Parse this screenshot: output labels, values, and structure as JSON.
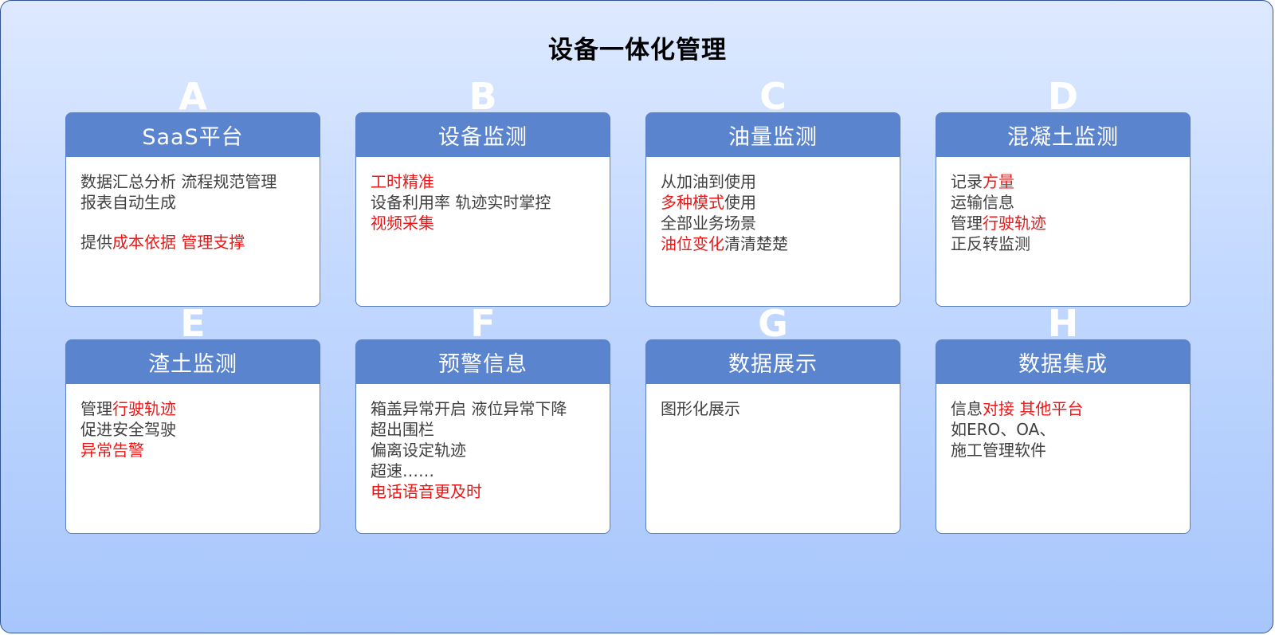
{
  "title": "设备一体化管理",
  "colors": {
    "header": "#5b84cf",
    "highlight": "#e81818",
    "text": "#404040"
  },
  "cards": [
    {
      "letter": "A",
      "title": "SaaS平台",
      "lines": [
        {
          "segments": [
            {
              "text": "数据汇总分析   流程规范管理",
              "highlight": false
            }
          ]
        },
        {
          "segments": [
            {
              "text": "报表自动生成",
              "highlight": false
            }
          ]
        },
        {
          "gap": true,
          "segments": [
            {
              "text": "提供",
              "highlight": false
            },
            {
              "text": "成本依据 管理支撑",
              "highlight": true
            }
          ]
        }
      ]
    },
    {
      "letter": "B",
      "title": "设备监测",
      "lines": [
        {
          "segments": [
            {
              "text": "工时精准",
              "highlight": true
            }
          ]
        },
        {
          "segments": [
            {
              "text": "设备利用率 轨迹实时掌控",
              "highlight": false
            }
          ]
        },
        {
          "segments": [
            {
              "text": "视频采集",
              "highlight": true
            }
          ]
        }
      ]
    },
    {
      "letter": "C",
      "title": "油量监测",
      "lines": [
        {
          "segments": [
            {
              "text": "从加油到使用",
              "highlight": false
            }
          ]
        },
        {
          "segments": [
            {
              "text": "多种模式",
              "highlight": true
            },
            {
              "text": "使用",
              "highlight": false
            }
          ]
        },
        {
          "segments": [
            {
              "text": "全部业务场景",
              "highlight": false
            }
          ]
        },
        {
          "segments": [
            {
              "text": "油位变化",
              "highlight": true
            },
            {
              "text": "清清楚楚",
              "highlight": false
            }
          ]
        }
      ]
    },
    {
      "letter": "D",
      "title": "混凝土监测",
      "lines": [
        {
          "segments": [
            {
              "text": "记录",
              "highlight": false
            },
            {
              "text": "方量",
              "highlight": true
            }
          ]
        },
        {
          "segments": [
            {
              "text": "运输信息",
              "highlight": false
            }
          ]
        },
        {
          "segments": [
            {
              "text": "管理",
              "highlight": false
            },
            {
              "text": "行驶轨迹",
              "highlight": true
            }
          ]
        },
        {
          "segments": [
            {
              "text": "正反转监测",
              "highlight": false
            }
          ]
        }
      ]
    },
    {
      "letter": "E",
      "title": "渣土监测",
      "lines": [
        {
          "segments": [
            {
              "text": "管理",
              "highlight": false
            },
            {
              "text": "行驶轨迹",
              "highlight": true
            }
          ]
        },
        {
          "segments": [
            {
              "text": "促进安全驾驶",
              "highlight": false
            }
          ]
        },
        {
          "segments": [
            {
              "text": "异常告警",
              "highlight": true
            }
          ]
        }
      ]
    },
    {
      "letter": "F",
      "title": "预警信息",
      "lines": [
        {
          "segments": [
            {
              "text": "箱盖异常开启 液位异常下降",
              "highlight": false
            }
          ]
        },
        {
          "segments": [
            {
              "text": "超出围栏",
              "highlight": false
            }
          ]
        },
        {
          "segments": [
            {
              "text": "偏离设定轨迹",
              "highlight": false
            }
          ]
        },
        {
          "segments": [
            {
              "text": "超速……",
              "highlight": false
            }
          ]
        },
        {
          "segments": [
            {
              "text": "电话语音更及时",
              "highlight": true
            }
          ]
        }
      ]
    },
    {
      "letter": "G",
      "title": "数据展示",
      "lines": [
        {
          "segments": [
            {
              "text": "图形化展示",
              "highlight": false
            }
          ]
        }
      ]
    },
    {
      "letter": "H",
      "title": "数据集成",
      "lines": [
        {
          "segments": [
            {
              "text": "信息",
              "highlight": false
            },
            {
              "text": "对接 其他平台",
              "highlight": true
            }
          ]
        },
        {
          "segments": [
            {
              "text": "如ERO、OA、",
              "highlight": false
            }
          ]
        },
        {
          "segments": [
            {
              "text": "施工管理软件",
              "highlight": false
            }
          ]
        }
      ]
    }
  ]
}
